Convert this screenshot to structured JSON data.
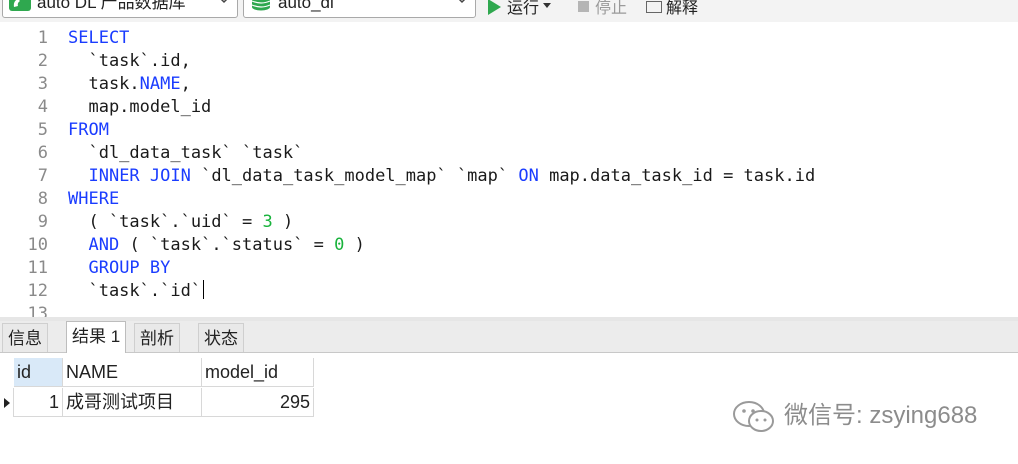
{
  "toolbar": {
    "connection": "auto DL 产品数据库",
    "database": "auto_dl",
    "run_label": "运行",
    "stop_label": "停止",
    "explain_label": "解释"
  },
  "editor": {
    "lines": [
      {
        "n": "1",
        "tokens": [
          {
            "t": "SELECT",
            "k": "kw"
          }
        ]
      },
      {
        "n": "2",
        "tokens": [
          {
            "t": "  `task`.id,",
            "k": ""
          }
        ]
      },
      {
        "n": "3",
        "tokens": [
          {
            "t": "  task.",
            "k": ""
          },
          {
            "t": "NAME",
            "k": "kw"
          },
          {
            "t": ",",
            "k": ""
          }
        ]
      },
      {
        "n": "4",
        "tokens": [
          {
            "t": "  map.model_id",
            "k": ""
          }
        ]
      },
      {
        "n": "5",
        "tokens": [
          {
            "t": "FROM",
            "k": "kw"
          }
        ]
      },
      {
        "n": "6",
        "tokens": [
          {
            "t": "  `dl_data_task` `task`",
            "k": ""
          }
        ]
      },
      {
        "n": "7",
        "tokens": [
          {
            "t": "  ",
            "k": ""
          },
          {
            "t": "INNER JOIN",
            "k": "kw"
          },
          {
            "t": " `dl_data_task_model_map` `map` ",
            "k": ""
          },
          {
            "t": "ON",
            "k": "kw"
          },
          {
            "t": " map.data_task_id = task.id",
            "k": ""
          }
        ]
      },
      {
        "n": "8",
        "tokens": [
          {
            "t": "WHERE",
            "k": "kw"
          }
        ]
      },
      {
        "n": "9",
        "tokens": [
          {
            "t": "  ( `task`.`uid` = ",
            "k": ""
          },
          {
            "t": "3",
            "k": "num"
          },
          {
            "t": " )",
            "k": ""
          }
        ]
      },
      {
        "n": "10",
        "tokens": [
          {
            "t": "  ",
            "k": ""
          },
          {
            "t": "AND",
            "k": "kw"
          },
          {
            "t": " ( `task`.`status` = ",
            "k": ""
          },
          {
            "t": "0",
            "k": "num"
          },
          {
            "t": " )",
            "k": ""
          }
        ]
      },
      {
        "n": "11",
        "tokens": [
          {
            "t": "  ",
            "k": ""
          },
          {
            "t": "GROUP BY",
            "k": "kw"
          }
        ]
      },
      {
        "n": "12",
        "tokens": [
          {
            "t": "  `task`.`id`",
            "k": ""
          }
        ],
        "cursor": true
      },
      {
        "n": "13",
        "tokens": []
      }
    ]
  },
  "tabs": [
    "信息",
    "结果 1",
    "剖析",
    "状态"
  ],
  "result": {
    "columns": [
      "id",
      "NAME",
      "model_id"
    ],
    "rows": [
      [
        "1",
        "成哥测试项目",
        "295"
      ]
    ]
  },
  "watermark": {
    "text": "微信号: zsying688"
  }
}
